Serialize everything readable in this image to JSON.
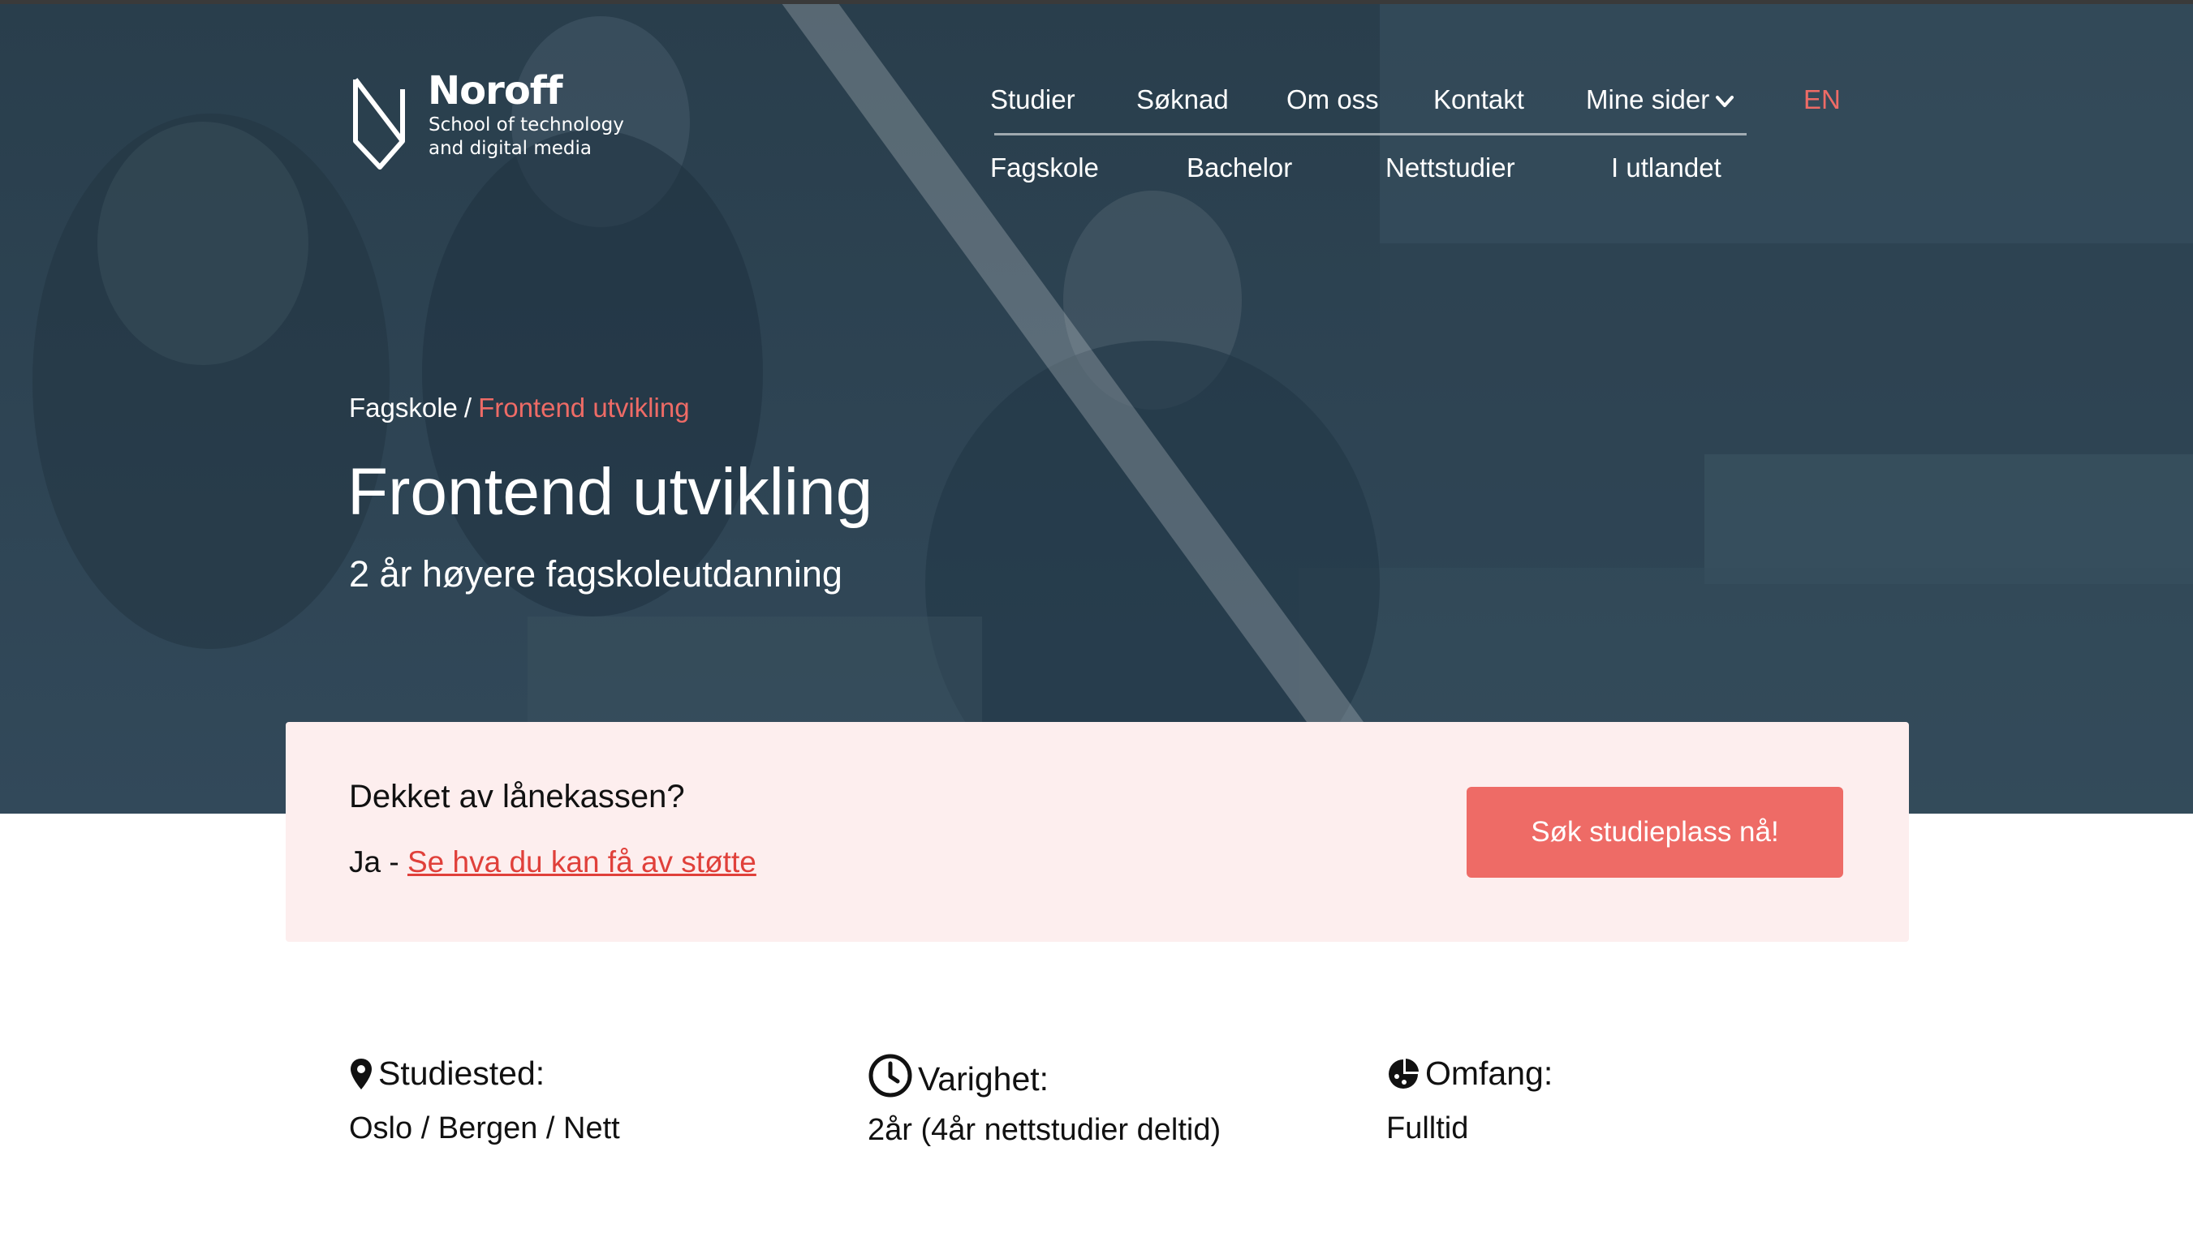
{
  "colors": {
    "accent": "#ee6b66",
    "link": "#e0403a",
    "hero_overlay": "#2f4655",
    "card_background": "#fdeeee",
    "text": "#111111"
  },
  "brand": {
    "name": "Noroff",
    "tagline_line1": "School of technology",
    "tagline_line2": "and digital media",
    "logo_icon": "noroff-shield-logo"
  },
  "nav": {
    "primary": [
      {
        "label": "Studier"
      },
      {
        "label": "Søknad"
      },
      {
        "label": "Om oss"
      },
      {
        "label": "Kontakt"
      },
      {
        "label": "Mine sider",
        "icon": "chevron-down-icon"
      }
    ],
    "language": "EN",
    "secondary": [
      {
        "label": "Fagskole"
      },
      {
        "label": "Bachelor"
      },
      {
        "label": "Nettstudier"
      },
      {
        "label": "I utlandet"
      }
    ]
  },
  "hero": {
    "breadcrumb": {
      "parent": "Fagskole",
      "separator": "/",
      "current": "Frontend utvikling"
    },
    "title": "Frontend utvikling",
    "subtitle": "2 år høyere fagskoleutdanning"
  },
  "loan": {
    "heading": "Dekket av lånekassen?",
    "answer_prefix": "Ja - ",
    "link_text": "Se hva du kan få av støtte",
    "button_label": "Søk studieplass nå!"
  },
  "facts": [
    {
      "icon": "location-pin-icon",
      "label": "Studiested:",
      "value": "Oslo / Bergen / Nett"
    },
    {
      "icon": "clock-icon",
      "label": "Varighet:",
      "value": "2år (4år nettstudier deltid)"
    },
    {
      "icon": "pie-chart-icon",
      "label": "Omfang:",
      "value": "Fulltid"
    }
  ]
}
